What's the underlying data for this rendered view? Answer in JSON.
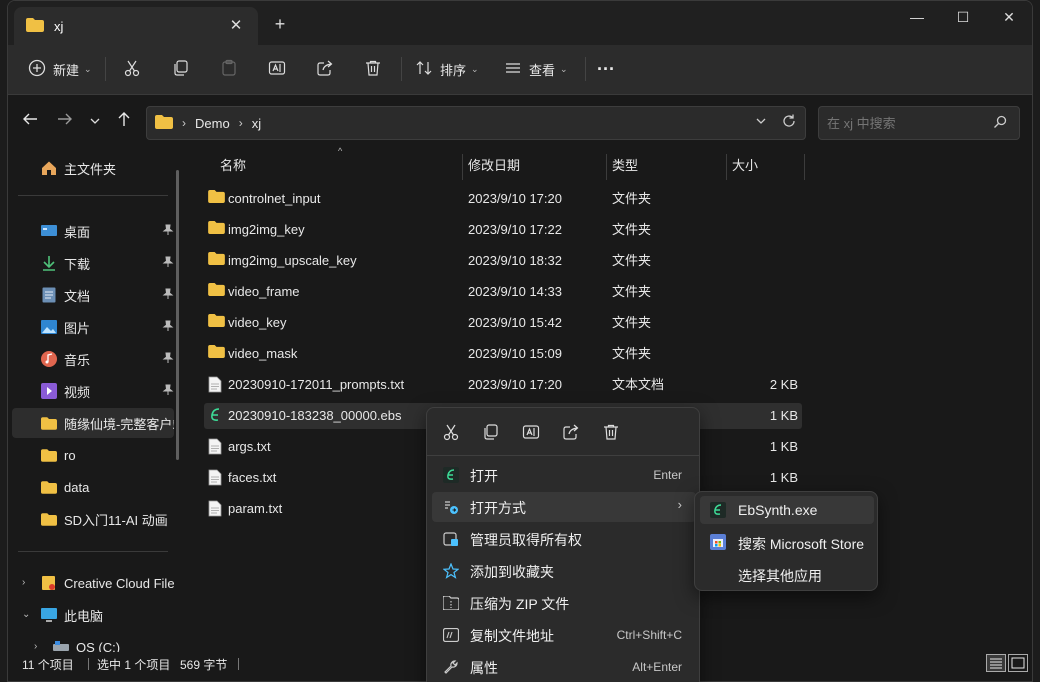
{
  "window": {
    "tab_title": "xj",
    "tab_close": "✕",
    "new_tab": "+",
    "minimize": "—",
    "maximize": "☐",
    "close": "✕"
  },
  "toolbar": {
    "new_label": "新建",
    "sort_label": "排序",
    "view_label": "查看",
    "more": "···"
  },
  "address": {
    "crumbs": [
      "Demo",
      "xj"
    ]
  },
  "search": {
    "placeholder": "在 xj 中搜索"
  },
  "sidebar": {
    "home": "主文件夹",
    "items": [
      {
        "label": "桌面",
        "icon": "desktop-icon"
      },
      {
        "label": "下载",
        "icon": "download-icon"
      },
      {
        "label": "文档",
        "icon": "document-icon"
      },
      {
        "label": "图片",
        "icon": "picture-icon"
      },
      {
        "label": "音乐",
        "icon": "music-icon"
      },
      {
        "label": "视频",
        "icon": "video-icon"
      },
      {
        "label": "随缘仙境-完整客户端",
        "icon": "folder-icon"
      },
      {
        "label": "ro",
        "icon": "folder-icon"
      },
      {
        "label": "data",
        "icon": "folder-icon"
      },
      {
        "label": "SD入门11-AI 动画",
        "icon": "folder-icon"
      }
    ],
    "creative_cloud": "Creative Cloud Files",
    "this_pc": "此电脑",
    "os_drive": "OS (C:)"
  },
  "columns": {
    "name": "名称",
    "date": "修改日期",
    "type": "类型",
    "size": "大小"
  },
  "files": [
    {
      "name": "controlnet_input",
      "date": "2023/9/10 17:20",
      "type": "文件夹",
      "size": "",
      "kind": "folder"
    },
    {
      "name": "img2img_key",
      "date": "2023/9/10 17:22",
      "type": "文件夹",
      "size": "",
      "kind": "folder"
    },
    {
      "name": "img2img_upscale_key",
      "date": "2023/9/10 18:32",
      "type": "文件夹",
      "size": "",
      "kind": "folder"
    },
    {
      "name": "video_frame",
      "date": "2023/9/10 14:33",
      "type": "文件夹",
      "size": "",
      "kind": "folder"
    },
    {
      "name": "video_key",
      "date": "2023/9/10 15:42",
      "type": "文件夹",
      "size": "",
      "kind": "folder"
    },
    {
      "name": "video_mask",
      "date": "2023/9/10 15:09",
      "type": "文件夹",
      "size": "",
      "kind": "folder"
    },
    {
      "name": "20230910-172011_prompts.txt",
      "date": "2023/9/10 17:20",
      "type": "文本文档",
      "size": "2 KB",
      "kind": "text"
    },
    {
      "name": "20230910-183238_00000.ebs",
      "date": "",
      "type": "",
      "size": "1 KB",
      "kind": "ebs"
    },
    {
      "name": "args.txt",
      "date": "",
      "type": "",
      "size": "1 KB",
      "kind": "text"
    },
    {
      "name": "faces.txt",
      "date": "",
      "type": "",
      "size": "1 KB",
      "kind": "text"
    },
    {
      "name": "param.txt",
      "date": "",
      "type": "",
      "size": "",
      "kind": "text"
    }
  ],
  "status": {
    "count": "11 个项目",
    "selected": "选中 1 个项目",
    "size": "569 字节"
  },
  "context_menu": {
    "items": [
      {
        "label": "打开",
        "shortcut": "Enter"
      },
      {
        "label": "打开方式",
        "shortcut": ""
      },
      {
        "label": "管理员取得所有权",
        "shortcut": ""
      },
      {
        "label": "添加到收藏夹",
        "shortcut": ""
      },
      {
        "label": "压缩为 ZIP 文件",
        "shortcut": ""
      },
      {
        "label": "复制文件地址",
        "shortcut": "Ctrl+Shift+C"
      },
      {
        "label": "属性",
        "shortcut": "Alt+Enter"
      }
    ]
  },
  "submenu": {
    "items": [
      {
        "label": "EbSynth.exe"
      },
      {
        "label": "搜索 Microsoft Store"
      },
      {
        "label": "选择其他应用"
      }
    ]
  },
  "colors": {
    "folder": "#f0c044",
    "accent": "#4cc2ff",
    "ebsynth": "#3ddc97"
  }
}
